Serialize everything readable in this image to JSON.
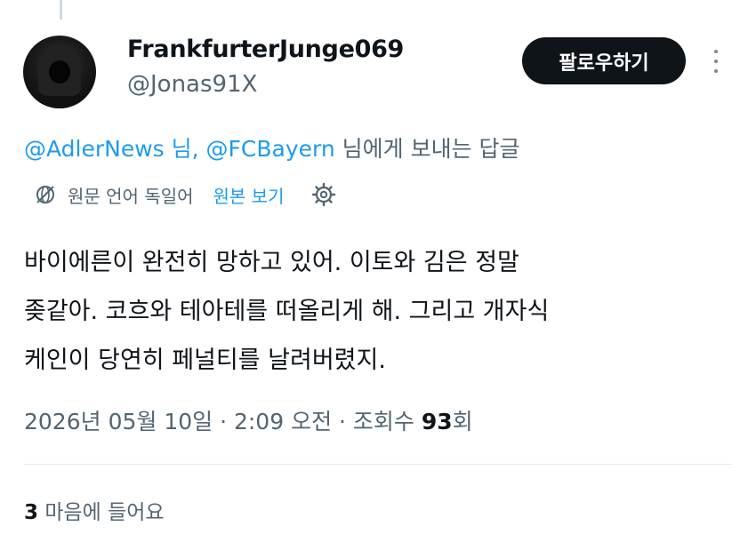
{
  "author": {
    "display_name": "FrankfurterJunge069",
    "handle": "@Jonas91X",
    "avatar_icon": "hooded-figure-avatar"
  },
  "follow_label": "팔로우하기",
  "more_icon": "vertical-dots-icon",
  "reply": {
    "mention1": "@AdlerNews",
    "sep1": " 님, ",
    "mention2": "@FCBayern",
    "suffix": " 님에게 보내는 답글"
  },
  "translation": {
    "icon": "globe-slash-icon",
    "label": "원문 언어 독일어",
    "view_original": "원본 보기",
    "settings_icon": "gear-icon"
  },
  "tweet": {
    "lines": [
      "바이에른이 완전히 망하고 있어. 이토와 김은 정말",
      "좆같아. 코흐와 테아테를 떠올리게 해. 그리고 개자식",
      "케인이 당연히 페널티를 날려버렸지."
    ]
  },
  "meta": {
    "timestamp": "2026년 05월 10일 · 2:09 오전 · 조회수 ",
    "views": "93",
    "views_suffix": "회"
  },
  "engagement": {
    "likes_count": "3",
    "likes_label": " 마음에 들어요"
  },
  "colors": {
    "link": "#1d9bf0",
    "secondary_text": "#536471",
    "primary_text": "#0f1419",
    "button_bg": "#0f1419"
  }
}
